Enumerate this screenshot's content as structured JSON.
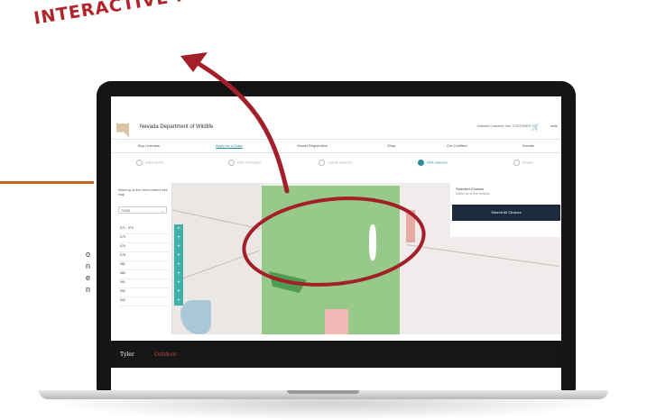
{
  "annotation": {
    "text": "INTERACTIVE MAP"
  },
  "side_caption": {
    "lines": [
      "o",
      "n",
      "e",
      "n"
    ]
  },
  "app": {
    "title": "Nevada Department of Wildlife",
    "customer": "Selected Customer: ###, CUSTOMER",
    "account_label": "####",
    "nav": [
      "Buy Licenses",
      "Apply for a Draw",
      "Vessel Registration",
      "Shop",
      "Get Certified",
      "Donate"
    ],
    "active_nav_index": 1,
    "steps": [
      "Select Hunts",
      "Enter Information",
      "License Selection",
      "Hunt Selection",
      "Review"
    ],
    "active_step_index": 3
  },
  "left_panel": {
    "label": "Select up to five hunt to select hunt map",
    "select_value": "7/2/26",
    "hunts": [
      "071 - 074",
      "073",
      "074",
      "075",
      "081",
      "082",
      "091",
      "092",
      "093"
    ],
    "add_icon": "+"
  },
  "right_panel": {
    "title": "Selected Choices",
    "subtitle": "Select up to five choices",
    "submit_label": "Submit All Choices"
  },
  "footer": {
    "brand": "Tyler",
    "brand_suffix": "Outdoor"
  },
  "colors": {
    "accent": "#2b8a9e",
    "annotation": "#b0252b",
    "map_green": "#8ec681",
    "submit": "#1c2b3c",
    "orange_rule": "#c8621b"
  }
}
